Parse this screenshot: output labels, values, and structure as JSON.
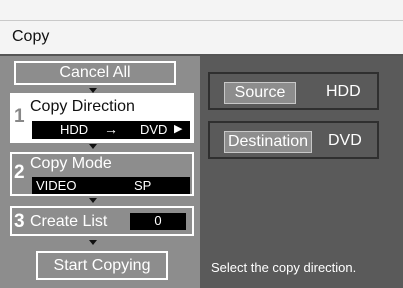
{
  "window": {
    "title": "Copy"
  },
  "buttons": {
    "cancel_all": "Cancel All",
    "start_copying": "Start Copying"
  },
  "steps": [
    {
      "number": "1",
      "label": "Copy Direction",
      "from": "HDD",
      "arrow": "→",
      "to": "DVD",
      "more": "▶"
    },
    {
      "number": "2",
      "label": "Copy Mode",
      "mode": "VIDEO",
      "quality": "SP"
    },
    {
      "number": "3",
      "label": "Create List",
      "count": "0"
    }
  ],
  "info": {
    "source_label": "Source",
    "source_value": "HDD",
    "destination_label": "Destination",
    "destination_value": "DVD"
  },
  "help_text": "Select the copy direction.",
  "colors": {
    "panel_gray": "#8d8d8d",
    "highlight_white": "#ffffff",
    "info_bg": "#5a5a5a"
  }
}
